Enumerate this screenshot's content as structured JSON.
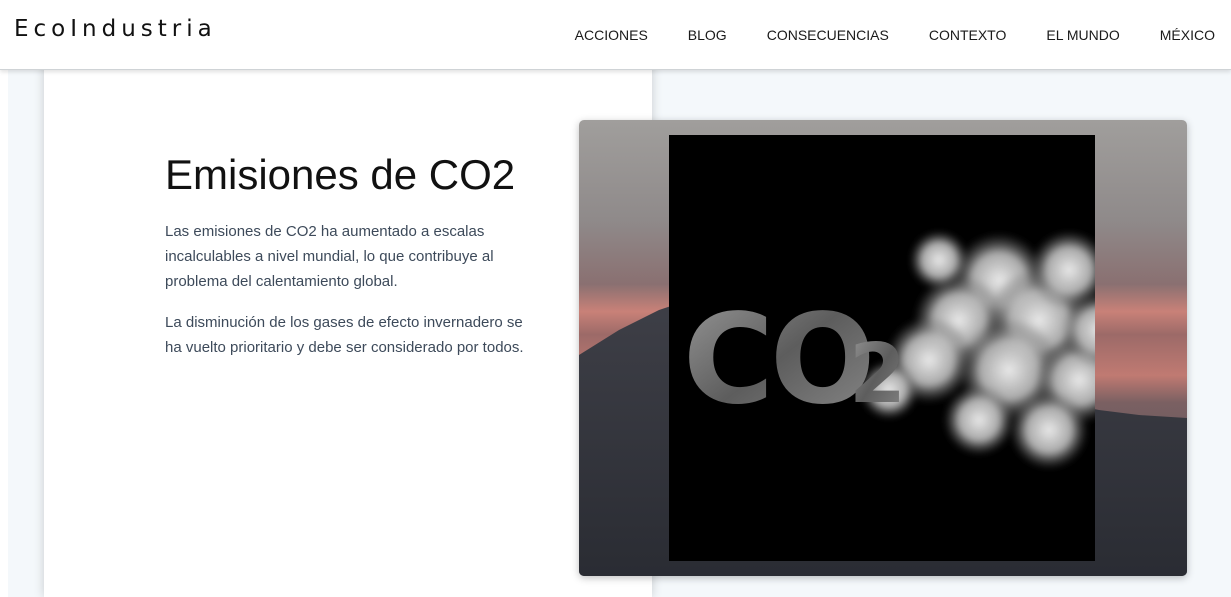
{
  "header": {
    "brand": "EcoIndustria",
    "nav": [
      {
        "label": "ACCIONES"
      },
      {
        "label": "BLOG"
      },
      {
        "label": "CONSECUENCIAS"
      },
      {
        "label": "CONTEXTO"
      },
      {
        "label": "EL MUNDO"
      },
      {
        "label": "MÉXICO"
      }
    ]
  },
  "main": {
    "title": "Emisiones de CO2",
    "paragraphs": [
      "Las emisiones de CO2 ha aumentado a escalas incalculables a nivel mundial, lo que contribuye al problema del calentamiento global.",
      "La disminución de los gases de efecto invernadero se ha vuelto prioritario y debe ser considerado por todos."
    ],
    "image": {
      "text": "CO",
      "subscript": "2"
    }
  },
  "colors": {
    "page_background": "#f4f8fb",
    "text_dark": "#111111",
    "paragraph_text": "#3d4a5a"
  }
}
